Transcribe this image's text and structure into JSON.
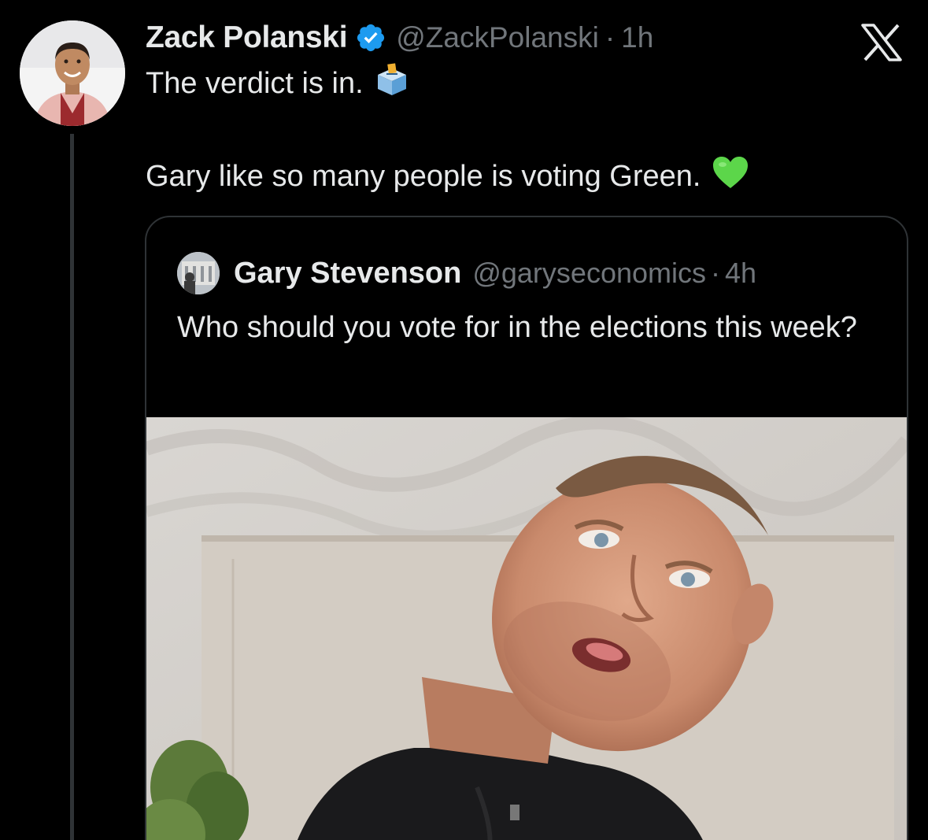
{
  "tweet": {
    "author": {
      "display_name": "Zack Polanski",
      "handle": "@ZackPolanski",
      "verified": true
    },
    "separator": "·",
    "time": "1h",
    "text_line1": "The verdict is in.",
    "text_line1_emoji": "ballot-box",
    "text_line2": "Gary like so many people is voting Green.",
    "text_line2_emoji": "green-heart"
  },
  "brand": {
    "logo": "x-logo"
  },
  "quoted_tweet": {
    "author": {
      "display_name": "Gary Stevenson",
      "handle": "@garyseconomics"
    },
    "separator": "·",
    "time": "4h",
    "text": "Who should you vote for in the elections this week?"
  },
  "colors": {
    "background": "#000000",
    "text_primary": "#e7e9ea",
    "text_secondary": "#71767b",
    "border": "#2f3336",
    "verified_blue": "#1d9bf0"
  }
}
